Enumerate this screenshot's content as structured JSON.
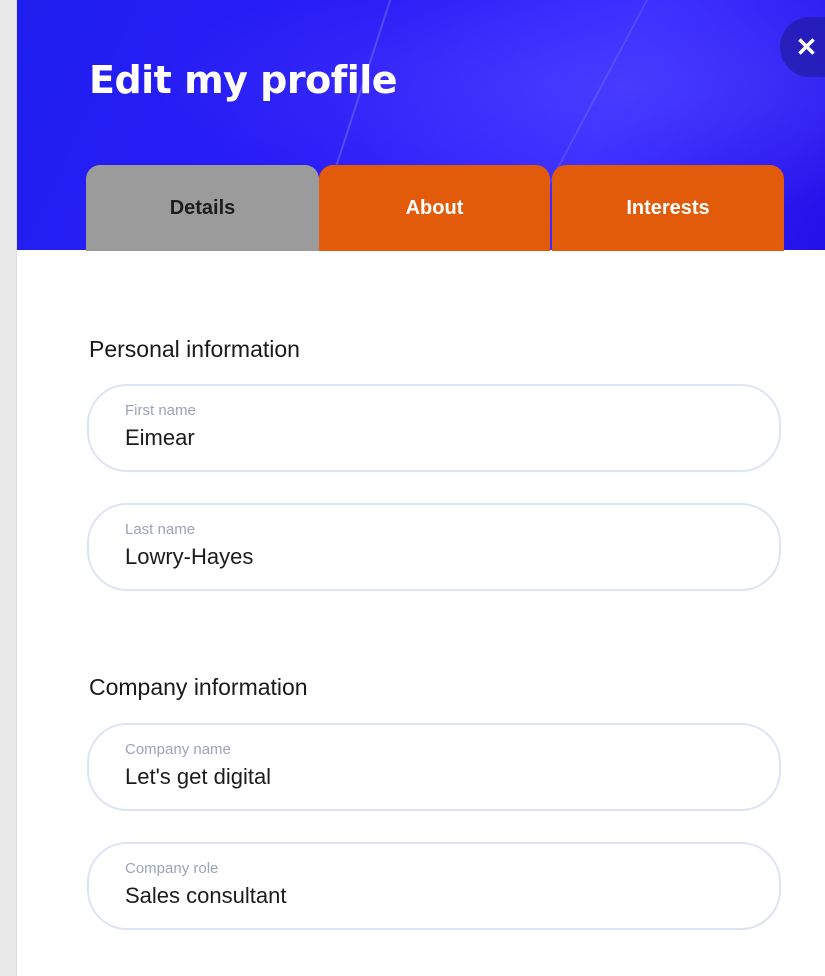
{
  "header": {
    "title": "Edit my profile",
    "close_label": "✕"
  },
  "tabs": [
    {
      "label": "Details",
      "active": true
    },
    {
      "label": "About",
      "active": false
    },
    {
      "label": "Interests",
      "active": false
    }
  ],
  "personal": {
    "heading": "Personal information",
    "first_name": {
      "label": "First name",
      "value": "Eimear"
    },
    "last_name": {
      "label": "Last name",
      "value": "Lowry-Hayes"
    }
  },
  "company": {
    "heading": "Company information",
    "name": {
      "label": "Company name",
      "value": "Let's get digital"
    },
    "role": {
      "label": "Company role",
      "value": "Sales consultant"
    }
  },
  "colors": {
    "header_blue": "#2418f2",
    "tab_orange": "#e15b0a",
    "tab_active_gray": "#9b9b9b",
    "field_border": "#dde3f3"
  },
  "icons": {
    "close": "close-icon"
  }
}
